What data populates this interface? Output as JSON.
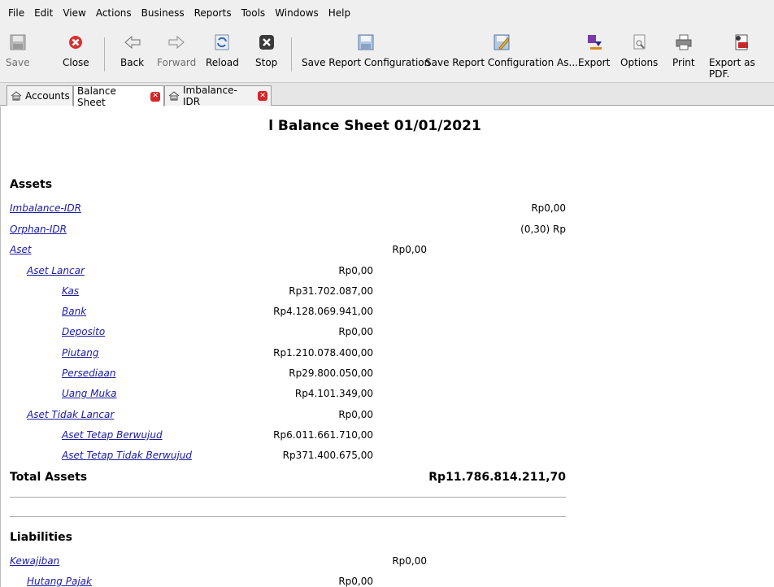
{
  "menu": [
    "File",
    "Edit",
    "View",
    "Actions",
    "Business",
    "Reports",
    "Tools",
    "Windows",
    "Help"
  ],
  "toolbar": {
    "save": "Save",
    "close": "Close",
    "back": "Back",
    "forward": "Forward",
    "reload": "Reload",
    "stop": "Stop",
    "save_config": "Save Report Configuration",
    "save_config_as": "Save Report Configuration As...",
    "export": "Export",
    "options": "Options",
    "print": "Print",
    "export_pdf": "Export as PDF."
  },
  "tabs": {
    "accounts": "Accounts",
    "balance_sheet": "Balance Sheet",
    "imbalance": "Imbalance-IDR"
  },
  "report": {
    "title": "l Balance Sheet 01/01/2021",
    "assets_heading": "Assets",
    "assets": [
      {
        "name": "Imbalance-IDR",
        "amount": "Rp0,00"
      },
      {
        "name": "Orphan-IDR",
        "amount": "(0,30) Rp"
      },
      {
        "name": "Aset",
        "amount": "Rp0,00"
      },
      {
        "name": "Aset Lancar",
        "amount": "Rp0,00"
      },
      {
        "name": "Kas",
        "amount": "Rp31.702.087,00"
      },
      {
        "name": "Bank",
        "amount": "Rp4.128.069.941,00"
      },
      {
        "name": "Deposito",
        "amount": "Rp0,00"
      },
      {
        "name": "Piutang",
        "amount": "Rp1.210.078.400,00"
      },
      {
        "name": "Persediaan",
        "amount": "Rp29.800.050,00"
      },
      {
        "name": "Uang Muka",
        "amount": "Rp4.101.349,00"
      },
      {
        "name": "Aset Tidak Lancar",
        "amount": "Rp0,00"
      },
      {
        "name": "Aset Tetap Berwujud",
        "amount": "Rp6.011.661.710,00"
      },
      {
        "name": "Aset Tetap Tidak Berwujud",
        "amount": "Rp371.400.675,00"
      }
    ],
    "total_assets_label": "Total Assets",
    "total_assets_amount": "Rp11.786.814.211,70",
    "liabilities_heading": "Liabilities",
    "liabilities": [
      {
        "name": "Kewajiban",
        "amount": "Rp0,00"
      },
      {
        "name": "Hutang Pajak",
        "amount": "Rp0,00"
      }
    ]
  }
}
